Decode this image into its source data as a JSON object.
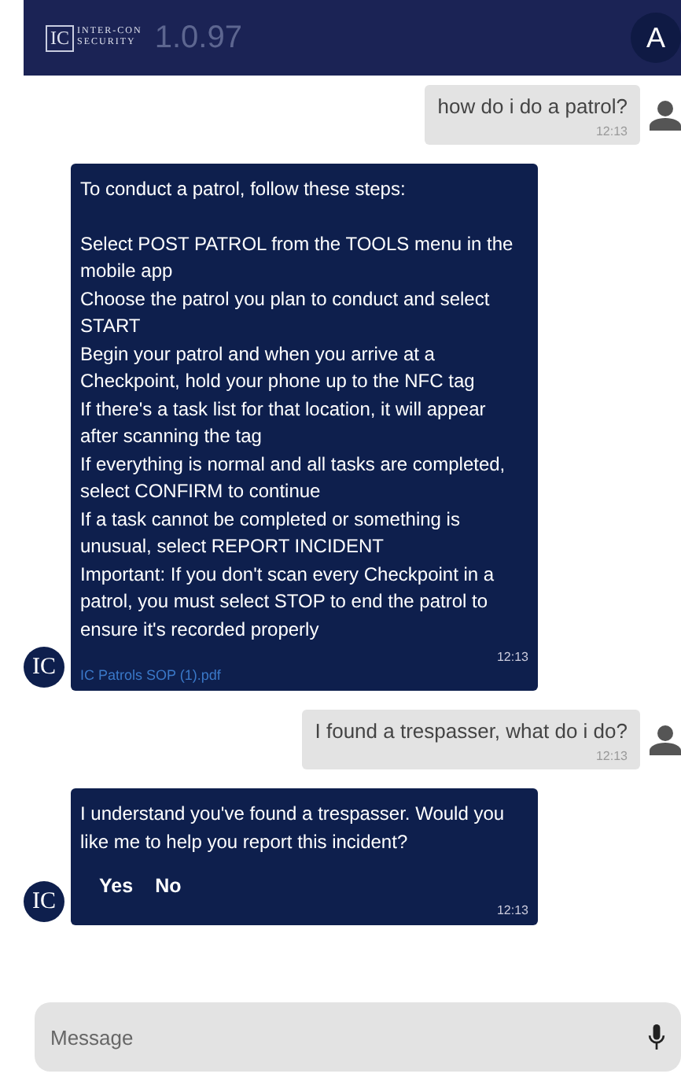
{
  "header": {
    "logo_mark": "IC",
    "logo_top": "INTER-CON",
    "logo_bottom": "SECURITY",
    "version": "1.0.97",
    "account_initial": "A"
  },
  "messages": [
    {
      "kind": "user",
      "text": "how do i do a patrol?",
      "time": "12:13"
    },
    {
      "kind": "bot",
      "avatar": "IC",
      "intro": "To conduct a patrol, follow these steps:",
      "lines": [
        "Select POST PATROL from the TOOLS menu in the mobile app",
        "Choose the patrol you plan to conduct and select START",
        "Begin your patrol and when you arrive at a Checkpoint, hold your phone up to the NFC tag",
        "If there's a task list for that location, it will appear after scanning the tag",
        "If everything is normal and all tasks are completed, select CONFIRM to continue",
        "If a task cannot be completed or something is unusual, select REPORT INCIDENT",
        "Important: If you don't scan every Checkpoint in a patrol, you must select STOP to end the patrol to ensure it's recorded properly"
      ],
      "time": "12:13",
      "attachment": "IC Patrols SOP (1).pdf"
    },
    {
      "kind": "user",
      "text": "I found a trespasser, what do i do?",
      "time": "12:13"
    },
    {
      "kind": "bot",
      "avatar": "IC",
      "intro": "I understand you've found a trespasser. Would you like me to help you report this incident?",
      "actions": [
        "Yes",
        "No"
      ],
      "time": "12:13"
    }
  ],
  "composer": {
    "placeholder": "Message"
  }
}
